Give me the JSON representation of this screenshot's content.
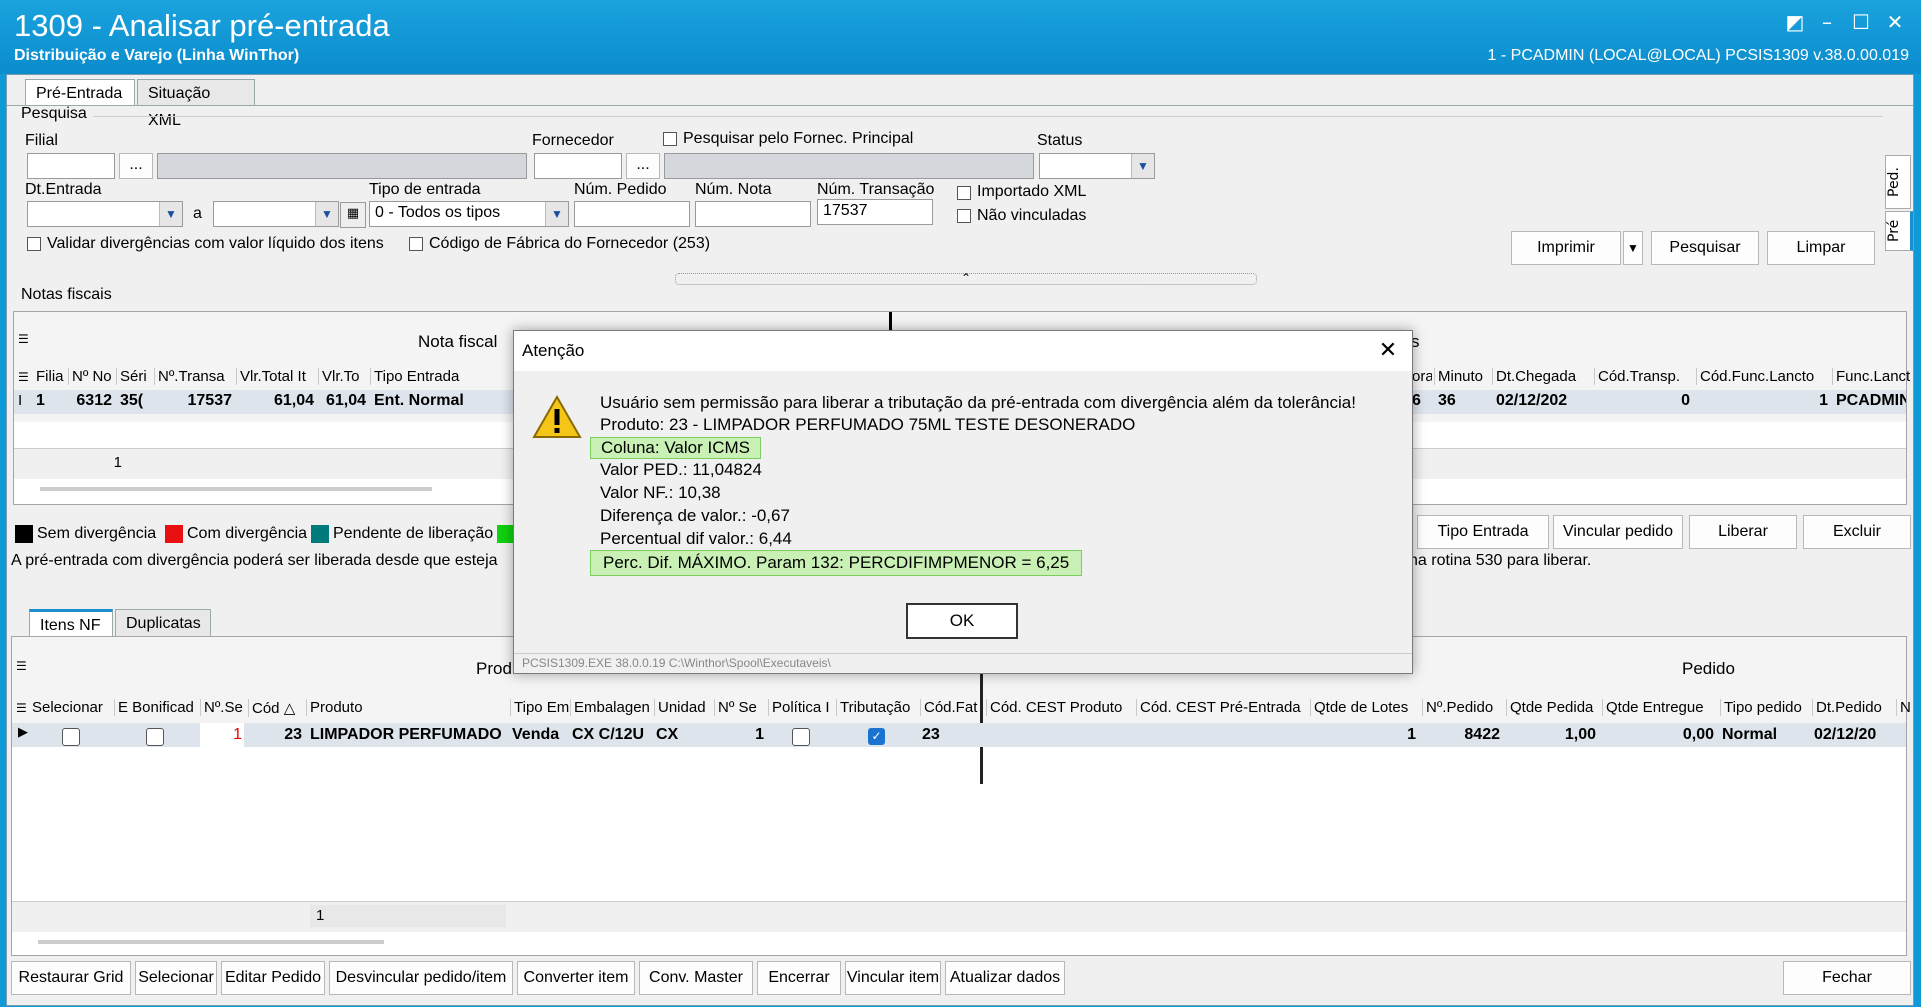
{
  "window": {
    "title": "1309 - Analisar pré-entrada",
    "subtitle": "Distribuição e Varejo (Linha WinThor)",
    "user_info": "1 - PCADMIN (LOCAL@LOCAL)   PCSIS1309  v.38.0.00.019"
  },
  "top_tabs": [
    "Pré-Entrada",
    "Situação XML"
  ],
  "search": {
    "group_label": "Pesquisa",
    "filial_label": "Filial",
    "fornecedor_label": "Fornecedor",
    "fornec_principal_label": "Pesquisar pelo Fornec. Principal",
    "status_label": "Status",
    "dt_entrada_label": "Dt.Entrada",
    "a_label": "a",
    "tipo_entrada_label": "Tipo de entrada",
    "tipo_entrada_value": "0 - Todos os tipos",
    "num_pedido_label": "Núm. Pedido",
    "num_nota_label": "Núm. Nota",
    "num_transacao_label": "Núm. Transação",
    "num_transacao_value": "17537",
    "importado_xml_label": "Importado XML",
    "nao_vinculadas_label": "Não vinculadas",
    "validar_label": "Validar divergências com valor líquido dos itens",
    "cod_fabrica_label": "Código de Fábrica do Fornecedor (253)",
    "ellipsis": "...",
    "btn_imprimir": "Imprimir",
    "btn_pesquisar": "Pesquisar",
    "btn_limpar": "Limpar",
    "side_tabs": [
      "Ped.",
      "Pré"
    ]
  },
  "notas": {
    "group_label": "Notas fiscais",
    "band_left": "Nota fiscal",
    "band_right_fragment": "s",
    "headers_left": [
      "Filia",
      "Nº No",
      "Séri",
      "Nº.Transa",
      "Vlr.Total It",
      "Vlr.To",
      "Tipo Entrada"
    ],
    "row_left": [
      "1",
      "6312",
      "35(",
      "17537",
      "61,04",
      "61,04",
      "Ent. Normal"
    ],
    "headers_right": [
      "ora",
      "Minuto",
      "Dt.Chegada",
      "Cód.Transp.",
      "Cód.Func.Lancto",
      "Func.Lancto"
    ],
    "row_right": [
      "6",
      "36",
      "02/12/202",
      "0",
      "1",
      "PCADMIN"
    ],
    "footer_count": "1"
  },
  "legend": {
    "items": [
      {
        "label": "Sem divergência",
        "color": "#000000"
      },
      {
        "label": "Com divergência",
        "color": "#e81010"
      },
      {
        "label": "Pendente de liberação",
        "color": "#007b7b"
      },
      {
        "label": "",
        "color": "#10d010"
      }
    ],
    "info_left": "A pré-entrada com divergência poderá ser liberada desde que esteja",
    "info_right": "na rotina 530 para liberar.",
    "btn_tipo_entrada": "Tipo Entrada",
    "btn_vincular_pedido": "Vincular pedido",
    "btn_liberar": "Liberar",
    "btn_excluir": "Excluir"
  },
  "item_tabs": [
    "Itens NF",
    "Duplicatas"
  ],
  "itens": {
    "band_produto": "Produt",
    "band_pedido": "Pedido",
    "headers": [
      "Selecionar",
      "E Bonificad",
      "Nº.Se",
      "Cód",
      "Produto",
      "Tipo Em",
      "Embalagen",
      "Unidad",
      "Nº Se",
      "Política I",
      "Tributação",
      "Cód.Fat",
      "Cód. CEST Produto",
      "Cód. CEST Pré-Entrada",
      "Qtde de Lotes",
      "Nº.Pedido",
      "Qtde Pedida",
      "Qtde Entregue",
      "Tipo pedido",
      "Dt.Pedido",
      "Nº"
    ],
    "row": {
      "seq": "1",
      "cod": "23",
      "produto": "LIMPADOR PERFUMADO",
      "tipo": "Venda",
      "embalagem": "CX C/12U",
      "unidade": "CX",
      "nseq": "1",
      "cod_fab": "23",
      "qtde_lotes": "1",
      "num_pedido": "8422",
      "qtde_pedida": "1,00",
      "qtde_entregue": "0,00",
      "tipo_pedido": "Normal",
      "dt_pedido": "02/12/20"
    },
    "footer_count": "1"
  },
  "bottom_buttons": [
    "Restaurar Grid",
    "Selecionar",
    "Editar Pedido",
    "Desvincular pedido/item",
    "Converter item",
    "Conv. Master",
    "Encerrar",
    "Vincular item",
    "Atualizar dados"
  ],
  "btn_fechar": "Fechar",
  "dialog": {
    "title": "Atenção",
    "lines": [
      "Usuário sem permissão para liberar a tributação da pré-entrada com divergência além da tolerância!",
      "Produto: 23 - LIMPADOR PERFUMADO 75ML TESTE DESONERADO",
      "Coluna: Valor ICMS",
      "Valor PED.: 11,04824",
      "Valor NF.: 10,38",
      "Diferença de valor.: -0,67",
      "Percentual dif valor.: 6,44",
      "Perc. Dif. MÁXIMO. Param 132: PERCDIFIMPMENOR = 6,25"
    ],
    "ok_label": "OK",
    "status": "PCSIS1309.EXE 38.0.0.19 C:\\Winthor\\Spool\\Executaveis\\"
  },
  "colors": {
    "titlebar": "#0e9ad6",
    "highlight": "#c9f0b5"
  }
}
